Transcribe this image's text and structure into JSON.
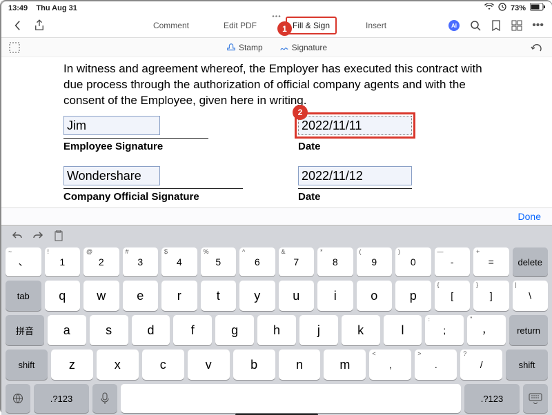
{
  "status": {
    "time": "13:49",
    "date": "Thu Aug 31",
    "battery": "73%"
  },
  "toolbar": {
    "tabs": [
      "Comment",
      "Edit PDF",
      "Fill & Sign",
      "Insert"
    ],
    "sub": {
      "stamp": "Stamp",
      "signature": "Signature"
    }
  },
  "doc": {
    "paragraph": "In witness and agreement whereof, the Employer has executed this contract with due process through the authorization of official company agents and with the consent of the Employee, given here in writing.",
    "emp_sig": "Jim",
    "emp_sig_label": "Employee Signature",
    "date1": "2022/11/11",
    "date_label": "Date",
    "company_sig": "Wondershare",
    "company_sig_label": "Company Official Signature",
    "date2": "2022/11/12",
    "date2_label": "Date"
  },
  "badges": {
    "one": "1",
    "two": "2"
  },
  "donebar": {
    "done": "Done"
  },
  "keyboard": {
    "row1": [
      {
        "sup": "~",
        "main": "、"
      },
      {
        "sup": "!",
        "main": "1"
      },
      {
        "sup": "@",
        "main": "2"
      },
      {
        "sup": "#",
        "main": "3"
      },
      {
        "sup": "$",
        "main": "4"
      },
      {
        "sup": "%",
        "main": "5"
      },
      {
        "sup": "^",
        "main": "6"
      },
      {
        "sup": "&",
        "main": "7"
      },
      {
        "sup": "*",
        "main": "8"
      },
      {
        "sup": "(",
        "main": "9"
      },
      {
        "sup": ")",
        "main": "0"
      },
      {
        "sup": "—",
        "main": "-"
      },
      {
        "sup": "+",
        "main": "="
      }
    ],
    "delete": "delete",
    "tab": "tab",
    "row2": [
      "q",
      "w",
      "e",
      "r",
      "t",
      "y",
      "u",
      "i",
      "o",
      "p"
    ],
    "row2b": [
      {
        "sup": "{",
        "main": "["
      },
      {
        "sup": "}",
        "main": "]"
      },
      {
        "sup": "|",
        "main": "\\"
      }
    ],
    "caps": "拼音",
    "row3": [
      "a",
      "s",
      "d",
      "f",
      "g",
      "h",
      "j",
      "k",
      "l"
    ],
    "row3b": [
      {
        "sup": ":",
        "main": ";"
      },
      {
        "sup": "\"",
        "main": "，"
      }
    ],
    "return": "return",
    "shift": "shift",
    "row4": [
      "z",
      "x",
      "c",
      "v",
      "b",
      "n",
      "m"
    ],
    "row4b": [
      {
        "sup": "<",
        "main": ","
      },
      {
        "sup": ">",
        "main": "."
      },
      {
        "sup": "?",
        "main": "/"
      }
    ],
    "numpad": ".?123"
  }
}
